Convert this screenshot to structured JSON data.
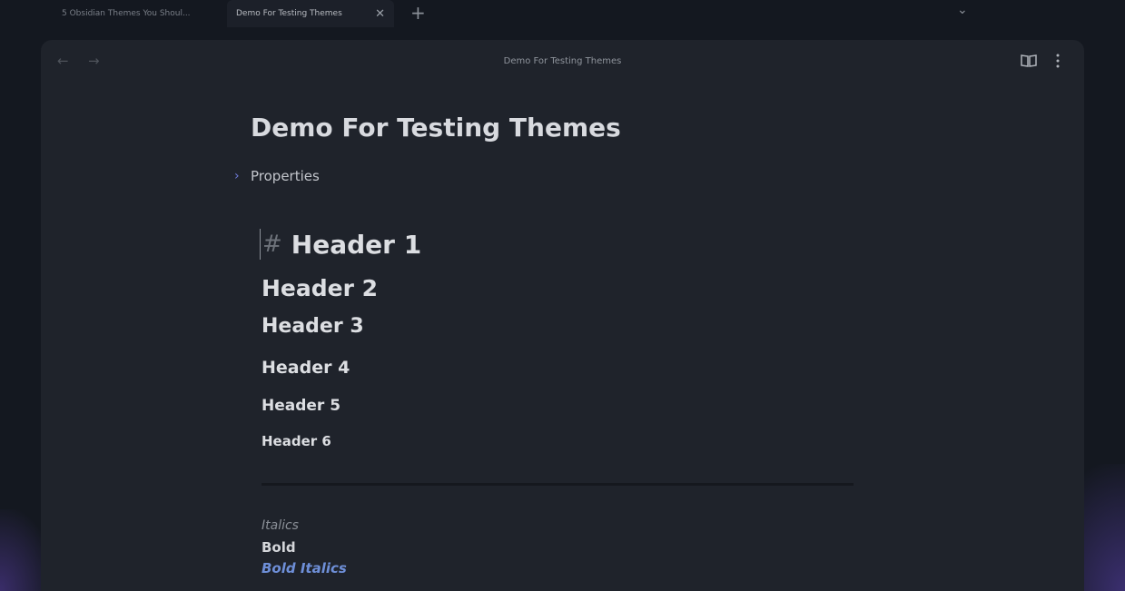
{
  "tabs": [
    {
      "label": "5 Obsidian Themes You Shoul...",
      "active": false
    },
    {
      "label": "Demo For Testing Themes",
      "active": true
    }
  ],
  "tabbar": {
    "new_tab_glyph": "+",
    "close_glyph": "✕",
    "list_glyph": "⌄"
  },
  "header": {
    "back_glyph": "←",
    "forward_glyph": "→",
    "view_title": "Demo For Testing Themes"
  },
  "document": {
    "title": "Demo For Testing Themes",
    "properties_label": "Properties",
    "properties_chevron": "›",
    "h1_marker": "#",
    "headings": {
      "h1": "Header 1",
      "h2": "Header 2",
      "h3": "Header 3",
      "h4": "Header 4",
      "h5": "Header 5",
      "h6": "Header 6"
    },
    "italics": "Italics",
    "bold": "Bold",
    "bold_italics": "Bold Italics"
  },
  "colors": {
    "background": "#141820",
    "pane": "#1f232b",
    "accent": "#6e8fd8",
    "chevron": "#6f7ad8"
  },
  "icons": [
    "back-arrow-icon",
    "forward-arrow-icon",
    "reading-view-icon",
    "more-options-icon",
    "close-icon",
    "plus-icon",
    "chevron-down-icon",
    "chevron-right-icon"
  ]
}
